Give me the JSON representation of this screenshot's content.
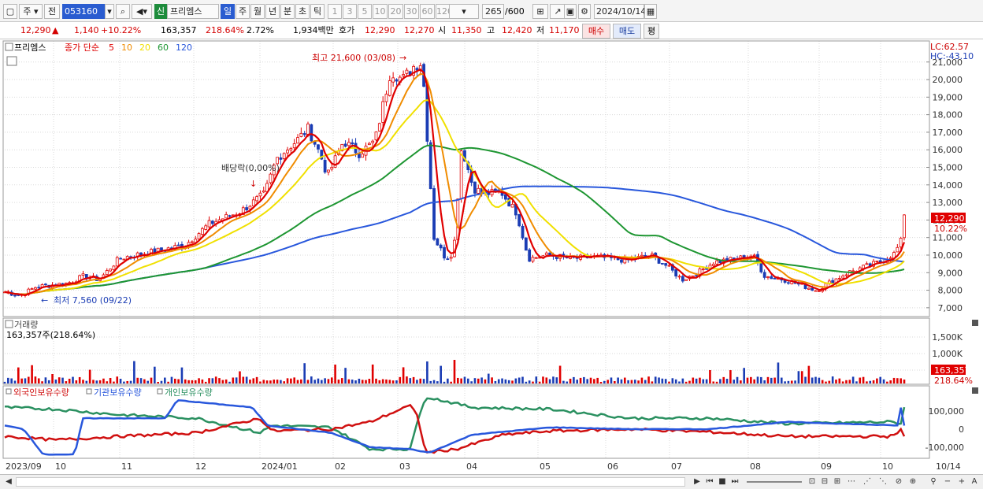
{
  "toolbar": {
    "market": "주",
    "prev": "전",
    "code": "053160",
    "badge": "신",
    "stock_name": "프리엠스",
    "periods": [
      "일",
      "주",
      "월",
      "년",
      "분",
      "초",
      "틱"
    ],
    "intervals": [
      "1",
      "3",
      "5",
      "10",
      "20",
      "30",
      "60",
      "120"
    ],
    "count": "265",
    "count_total": "/600",
    "date": "2024/10/14"
  },
  "quote": {
    "price": "12,290",
    "arrow": "▲",
    "change": "1,140",
    "change_pct": "+10.22%",
    "volume": "163,357",
    "vol_ratio": "218.64%",
    "turnover": "2.72%",
    "amount": "1,934백만",
    "bid_label": "호가",
    "ask": "12,290",
    "bid": "12,270",
    "open_label": "시",
    "open": "11,350",
    "high_label": "고",
    "high": "12,420",
    "low_label": "저",
    "low": "11,170",
    "buy": "매수",
    "sell": "매도",
    "eval": "평"
  },
  "price_panel": {
    "name": "프리엠스",
    "ma_label": "종가 단순",
    "ma_periods": [
      "5",
      "10",
      "20",
      "60",
      "120"
    ],
    "ma_colors": [
      "#e00000",
      "#f08c00",
      "#f0e000",
      "#1e9632",
      "#2857dc"
    ],
    "high_note": "최고 21,600 (03/08)",
    "low_note": "최저 7,560 (09/22)",
    "dividend_note": "배당락(0,00%)",
    "lc": "LC:62.57",
    "hc": "HC:-43.10",
    "y_ticks": [
      "21,000",
      "20,000",
      "19,000",
      "18,000",
      "17,000",
      "16,000",
      "15,000",
      "14,000",
      "13,000",
      "12,000",
      "11,000",
      "10,000",
      "9,000",
      "8,000",
      "7,000"
    ],
    "last_price": "12,290",
    "last_pct": "10.22%"
  },
  "volume_panel": {
    "title": "거래량",
    "value": "163,357주(218.64%)",
    "y_ticks": [
      "1,500K",
      "1,000K",
      "500K"
    ],
    "last_vol": "163,357",
    "last_pct": "218.64%"
  },
  "holdings_panel": {
    "series": [
      {
        "name": "외국인보유수량",
        "color": "#d01010"
      },
      {
        "name": "기관보유수량",
        "color": "#2857dc"
      },
      {
        "name": "개인보유수량",
        "color": "#2a9060"
      }
    ],
    "y_ticks": [
      "100,000",
      "0",
      "-100,000"
    ]
  },
  "x_axis": [
    "2023/09",
    "10",
    "11",
    "12",
    "2024/01",
    "02",
    "03",
    "04",
    "05",
    "06",
    "07",
    "08",
    "09",
    "10",
    "10/14"
  ],
  "chart_data": {
    "type": "line",
    "x": [
      "2023/09",
      "10",
      "11",
      "12",
      "2024/01",
      "02",
      "03",
      "04",
      "05",
      "06",
      "07",
      "08",
      "09",
      "10"
    ],
    "series": [
      {
        "name": "종가",
        "values": [
          7900,
          8200,
          10000,
          12000,
          16800,
          16000,
          21000,
          13500,
          10000,
          10000,
          8600,
          9000,
          8100,
          11000
        ]
      }
    ],
    "ylim": [
      7000,
      21600
    ]
  }
}
